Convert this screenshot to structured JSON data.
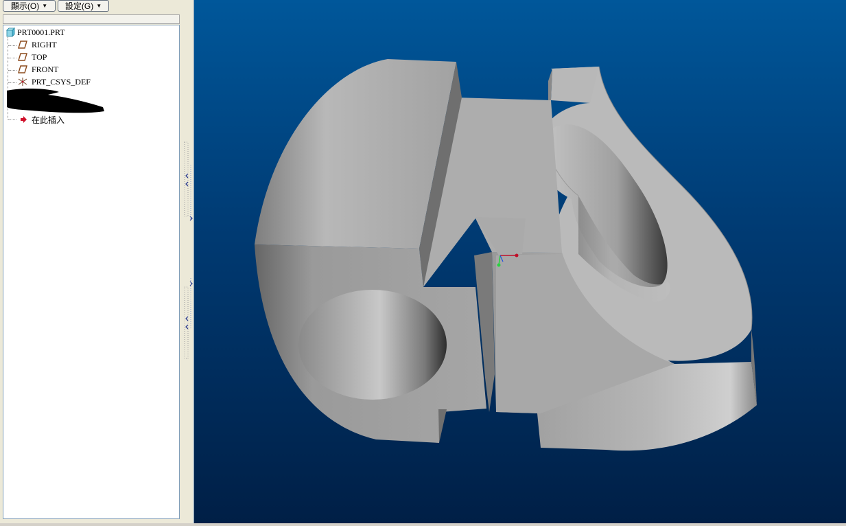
{
  "toolbar": {
    "display_button": "顯示(O)",
    "settings_button": "設定(G)"
  },
  "model_tree": {
    "root": "PRT0001.PRT",
    "items": [
      {
        "label": "RIGHT",
        "icon": "datum-plane-icon"
      },
      {
        "label": "TOP",
        "icon": "datum-plane-icon"
      },
      {
        "label": "FRONT",
        "icon": "datum-plane-icon"
      },
      {
        "label": "PRT_CSYS_DEF",
        "icon": "coordinate-system-icon"
      }
    ],
    "insert_here": "在此插入"
  },
  "colors": {
    "viewport_top": "#00579a",
    "viewport_bottom": "#001f46",
    "part_face": "#b4b4b4",
    "insert_arrow": "#d0102a",
    "datum_icon": "#8b4a1c"
  }
}
